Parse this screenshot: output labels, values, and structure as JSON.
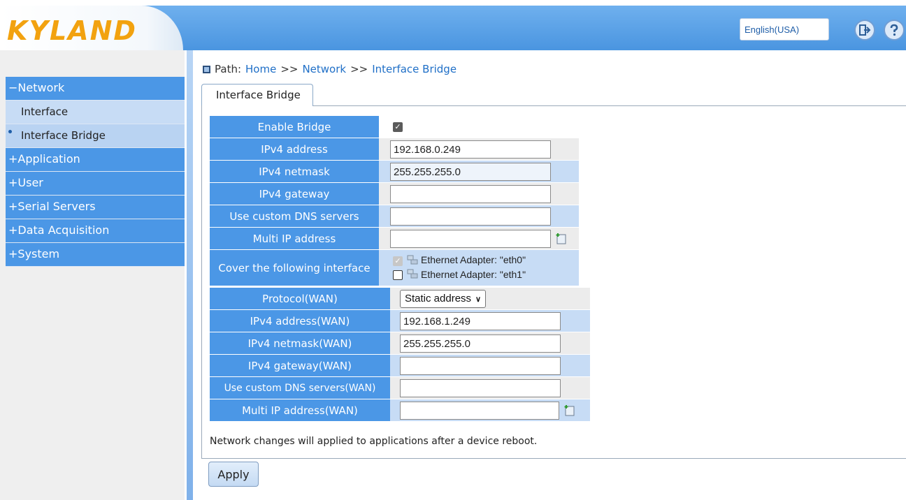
{
  "header": {
    "logo_text": "KYLAND",
    "language_value": "English(USA)",
    "logout_icon": "logout-arrow-icon",
    "help_icon": "help-question-icon",
    "brand_color": "#f2a20f",
    "accent_color": "#4b97e6"
  },
  "sidebar": {
    "sections": [
      {
        "label": "−Network",
        "expanded": true
      },
      {
        "label": "+Application"
      },
      {
        "label": "+User"
      },
      {
        "label": "+Serial Servers"
      },
      {
        "label": "+Data Acquisition"
      },
      {
        "label": "+System"
      }
    ],
    "network_items": [
      {
        "label": "Interface",
        "active": false
      },
      {
        "label": "Interface Bridge",
        "active": true
      }
    ]
  },
  "breadcrumb": {
    "prefix": "Path:",
    "home": "Home",
    "sep1": ">>",
    "network": "Network",
    "sep2": ">>",
    "current": "Interface Bridge"
  },
  "tab": {
    "label": "Interface Bridge"
  },
  "form": {
    "enable_bridge": {
      "label": "Enable Bridge",
      "checked": true
    },
    "ipv4_address": {
      "label": "IPv4 address",
      "value": "192.168.0.249"
    },
    "ipv4_netmask": {
      "label": "IPv4 netmask",
      "value": "255.255.255.0"
    },
    "ipv4_gateway": {
      "label": "IPv4 gateway",
      "value": ""
    },
    "dns": {
      "label": "Use custom DNS servers",
      "value": ""
    },
    "multi_ip": {
      "label": "Multi IP address",
      "value": ""
    },
    "cover": {
      "label": "Cover the following interface",
      "adapters": [
        {
          "label": "Ethernet Adapter: \"eth0\"",
          "checked": true,
          "disabled": true
        },
        {
          "label": "Ethernet Adapter: \"eth1\"",
          "checked": false,
          "disabled": false
        }
      ]
    },
    "protocol_wan": {
      "label": "Protocol(WAN)",
      "value": "Static address"
    },
    "ipv4_address_wan": {
      "label": "IPv4 address(WAN)",
      "value": "192.168.1.249"
    },
    "ipv4_netmask_wan": {
      "label": "IPv4 netmask(WAN)",
      "value": "255.255.255.0"
    },
    "ipv4_gateway_wan": {
      "label": "IPv4 gateway(WAN)",
      "value": ""
    },
    "dns_wan": {
      "label": "Use custom DNS servers(WAN)",
      "value": ""
    },
    "multi_ip_wan": {
      "label": "Multi IP address(WAN)",
      "value": ""
    }
  },
  "note": "Network changes will applied to applications after a device reboot.",
  "apply_label": "Apply"
}
